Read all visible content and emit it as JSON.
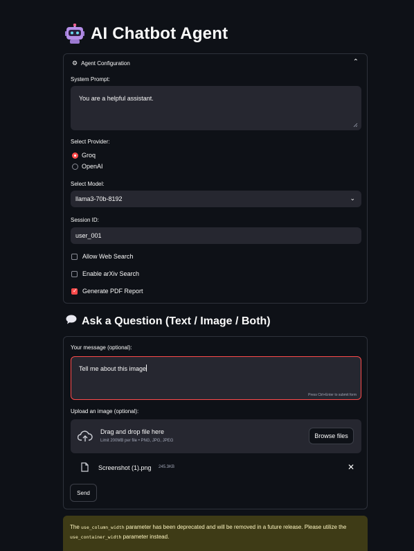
{
  "app": {
    "title": "AI Chatbot Agent",
    "icon": "robot-icon"
  },
  "config": {
    "header": "Agent Configuration",
    "header_icon": "gear-icon",
    "system_prompt_label": "System Prompt:",
    "system_prompt_value": "You are a helpful assistant.",
    "provider_label": "Select Provider:",
    "providers": [
      {
        "label": "Groq",
        "selected": true
      },
      {
        "label": "OpenAI",
        "selected": false
      }
    ],
    "model_label": "Select Model:",
    "model_value": "llama3-70b-8192",
    "session_label": "Session ID:",
    "session_value": "user_001",
    "options": [
      {
        "label": "Allow Web Search",
        "checked": false
      },
      {
        "label": "Enable arXiv Search",
        "checked": false
      },
      {
        "label": "Generate PDF Report",
        "checked": true
      }
    ]
  },
  "ask": {
    "heading": "Ask a Question (Text / Image / Both)",
    "heading_icon": "speech-bubble-icon",
    "message_label": "Your message (optional):",
    "message_value": "Tell me about this image",
    "submit_hint": "Press Ctrl+Enter to submit form",
    "upload_label": "Upload an image (optional):",
    "dropzone_title": "Drag and drop file here",
    "dropzone_limit": "Limit 200MB per file • PNG, JPG, JPEG",
    "browse_label": "Browse files",
    "file_name": "Screenshot (1).png",
    "file_size": "245.3KB",
    "send_label": "Send"
  },
  "warning": {
    "part1": "The ",
    "code1": "use_column_width",
    "part2": " parameter has been deprecated and will be removed in a future release. Please utilize the ",
    "code2": "use_container_width",
    "part3": " parameter instead."
  },
  "colors": {
    "background": "#0e1117",
    "widget": "#262730",
    "accent": "#ff4b4b",
    "warning_bg": "#3e3b16",
    "warning_text": "#fff7c4"
  }
}
